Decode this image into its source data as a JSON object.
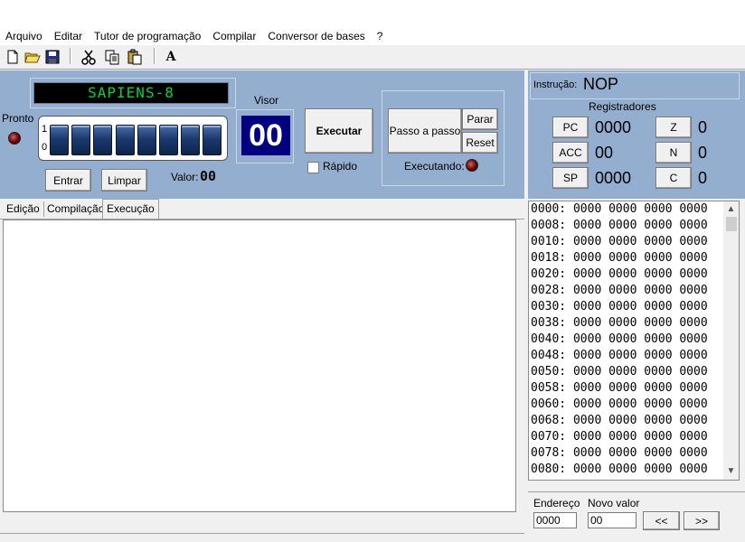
{
  "menu": [
    "Arquivo",
    "Editar",
    "Tutor de programação",
    "Compilar",
    "Conversor de bases",
    "?"
  ],
  "toolbar": {
    "icons": [
      "new-file-icon",
      "open-folder-icon",
      "save-icon",
      "cut-icon",
      "copy-icon",
      "paste-icon",
      "font-icon"
    ],
    "font_glyph": "A"
  },
  "display": {
    "lcd_text": "SAPIENS-8",
    "visor_label": "Visor",
    "visor_value": "00"
  },
  "switches": {
    "label_ready": "Pronto",
    "one": "1",
    "zero": "0",
    "count": 8
  },
  "buttons": {
    "enter": "Entrar",
    "clear": "Limpar",
    "value_label": "Valor:",
    "value": "00",
    "execute": "Executar",
    "fast": "Rápido",
    "step": "Passo a passo",
    "stop": "Parar",
    "reset": "Reset",
    "running": "Executando:"
  },
  "tabs": [
    "Edição",
    "Compilação",
    "Execução"
  ],
  "active_tab": "Execução",
  "instruction": {
    "label": "Instrução:",
    "value": "NOP"
  },
  "registers": {
    "title": "Registradores",
    "pc": {
      "name": "PC",
      "value": "0000"
    },
    "acc": {
      "name": "ACC",
      "value": "00"
    },
    "sp": {
      "name": "SP",
      "value": "0000"
    },
    "z": {
      "name": "Z",
      "value": "0"
    },
    "n": {
      "name": "N",
      "value": "0"
    },
    "c": {
      "name": "C",
      "value": "0"
    }
  },
  "memory": [
    "0000: 0000 0000 0000 0000",
    "0008: 0000 0000 0000 0000",
    "0010: 0000 0000 0000 0000",
    "0018: 0000 0000 0000 0000",
    "0020: 0000 0000 0000 0000",
    "0028: 0000 0000 0000 0000",
    "0030: 0000 0000 0000 0000",
    "0038: 0000 0000 0000 0000",
    "0040: 0000 0000 0000 0000",
    "0048: 0000 0000 0000 0000",
    "0050: 0000 0000 0000 0000",
    "0058: 0000 0000 0000 0000",
    "0060: 0000 0000 0000 0000",
    "0068: 0000 0000 0000 0000",
    "0070: 0000 0000 0000 0000",
    "0078: 0000 0000 0000 0000",
    "0080: 0000 0000 0000 0000"
  ],
  "memory_edit": {
    "address_label": "Endereço",
    "new_value_label": "Novo valor",
    "address": "0000",
    "new_value": "00",
    "prev": "<<",
    "next": ">>"
  }
}
